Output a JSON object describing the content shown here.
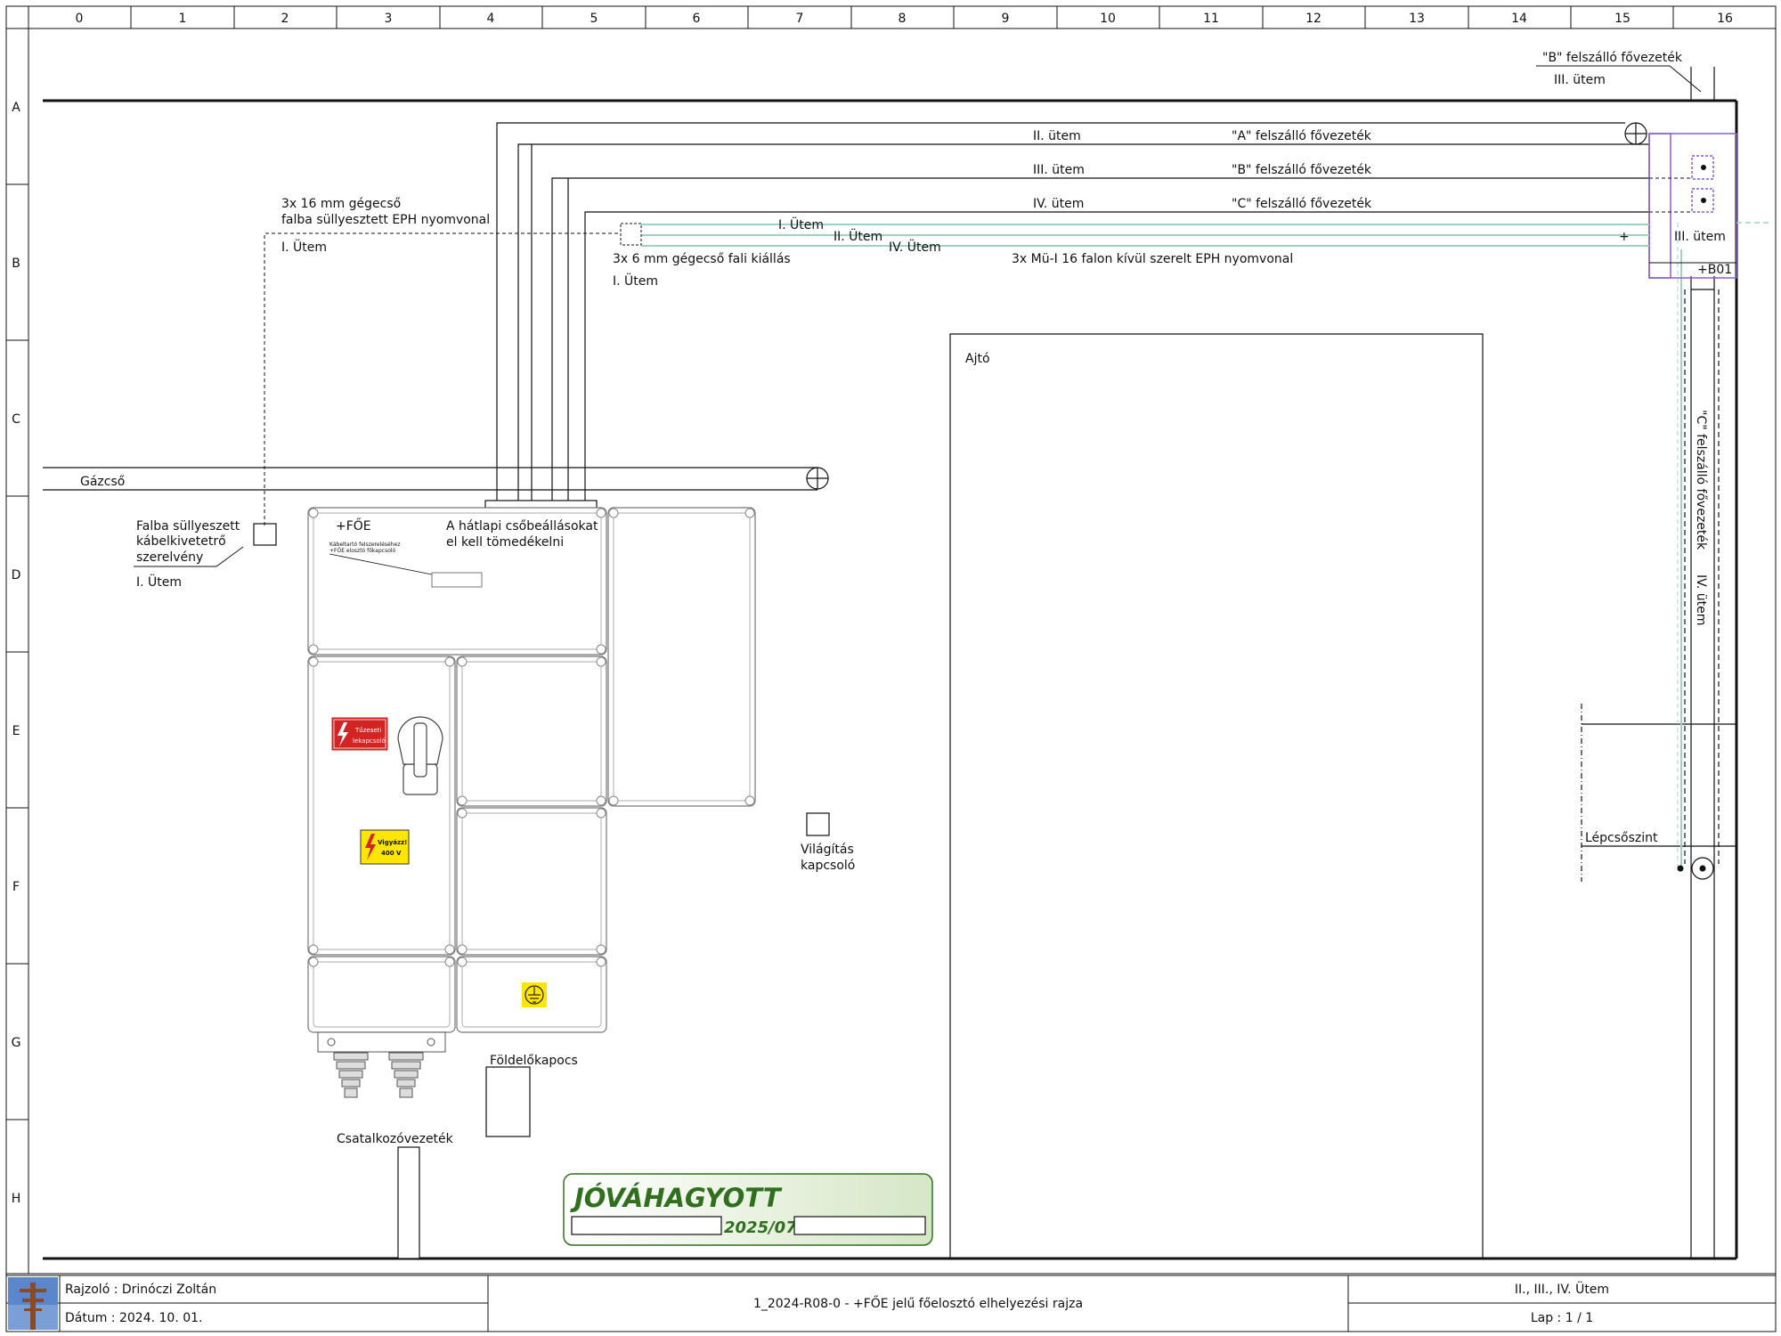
{
  "frame": {
    "columns": [
      "0",
      "1",
      "2",
      "3",
      "4",
      "5",
      "6",
      "7",
      "8",
      "9",
      "10",
      "11",
      "12",
      "13",
      "14",
      "15",
      "16"
    ],
    "rows": [
      "A",
      "B",
      "C",
      "D",
      "E",
      "F",
      "G",
      "H"
    ]
  },
  "labels": {
    "riser_b_top": "\"B\" felszálló fővezeték",
    "riser_b_top_stage": "III. ütem",
    "line_a_stage": "II. ütem",
    "line_a_name": "\"A\" felszálló fővezeték",
    "line_b_stage": "III. ütem",
    "line_b_name": "\"B\" felszálló fővezeték",
    "line_c_stage": "IV. ütem",
    "line_c_name": "\"C\" felszálló fővezeték",
    "conduit16_line1": "3x 16 mm gégecső",
    "conduit16_line2": "falba süllyesztett EPH nyomvonal",
    "conduit16_stage": "I. Ütem",
    "eph1_stage": "I. Ütem",
    "eph2_stage": "II. Ütem",
    "eph3_stage": "IV. Ütem",
    "conduit6": "3x 6 mm gégecső fali kiállás",
    "conduit6_stage": "I. Ütem",
    "mui16": "3x Mü-I 16 falon kívül szerelt EPH nyomvonal",
    "right_stage": "III. ütem",
    "b01": "+B01",
    "riser_c_vertical": "\"C\" felszálló fővezeték",
    "riser_c_vertical_stage": "IV. ütem",
    "door": "Ajtó",
    "gas_pipe": "Gázcső",
    "junction_line1": "Falba süllyeszett",
    "junction_line2": "kábelkivetetrő",
    "junction_line3": "szerelvény",
    "junction_stage": "I. Ütem",
    "panel_id": "+FŐE",
    "panel_note_line1": "A hátlapi csőbeállásokat",
    "panel_note_line2": "el kell tömedékelni",
    "panel_small_line1": "Kábeltartó felszereléséhez",
    "panel_small_line2": "+FŐE elosztó főkapcsoló",
    "fire_switch_line1": "Tűzeseti",
    "fire_switch_line2": "lekapcsoló",
    "warning_line1": "Vigyázz!",
    "warning_line2": "400 V",
    "light_switch_line1": "Világítás",
    "light_switch_line2": "kapcsoló",
    "ground_terminal": "Földelőkapocs",
    "service_cable": "Csatalkozóvezeték",
    "stair_level": "Lépcsőszint"
  },
  "stamp": {
    "title": "JÓVÁHAGYOTT",
    "date": "2025/07"
  },
  "title_block": {
    "drawer": "Rajzoló : Drinóczi Zoltán",
    "date": "Dátum : 2024. 10. 01.",
    "drawing_title": "1_2024-R08-0 - +FŐE jelű főelosztó elhelyezési rajza",
    "stages": "II., III., IV. Ütem",
    "sheet": "Lap : 1 / 1"
  },
  "icons": {
    "logo": "utility-pole-logo-icon",
    "fire_switch": "lightning-icon",
    "warning": "high-voltage-icon",
    "ground": "ground-symbol-icon",
    "riser_symbol": "crossed-circle-icon"
  },
  "colors": {
    "line": "#111111",
    "eph_line": "#9fd3c8",
    "purple_box": "#8a5cd6",
    "stamp_green": "#2f6f1e",
    "stamp_bg": "#e6f1dc",
    "fire_sign": "#d32323",
    "warning_sign": "#ffe600"
  }
}
